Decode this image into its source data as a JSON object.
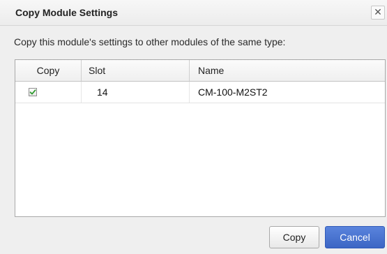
{
  "dialog": {
    "title": "Copy Module Settings",
    "close_glyph": "✕",
    "instruction": "Copy this module's settings to other modules of the same type:"
  },
  "table": {
    "headers": {
      "copy": "Copy",
      "slot": "Slot",
      "name": "Name"
    },
    "rows": [
      {
        "copy_checked": true,
        "slot": "14",
        "name": "CM-100-M2ST2"
      }
    ]
  },
  "buttons": {
    "copy": "Copy",
    "cancel": "Cancel"
  },
  "colors": {
    "primary_button": "#3c66c4",
    "checkmark": "#2e9a2e"
  },
  "icons": {
    "close": "close-icon",
    "check": "checkmark-icon"
  }
}
